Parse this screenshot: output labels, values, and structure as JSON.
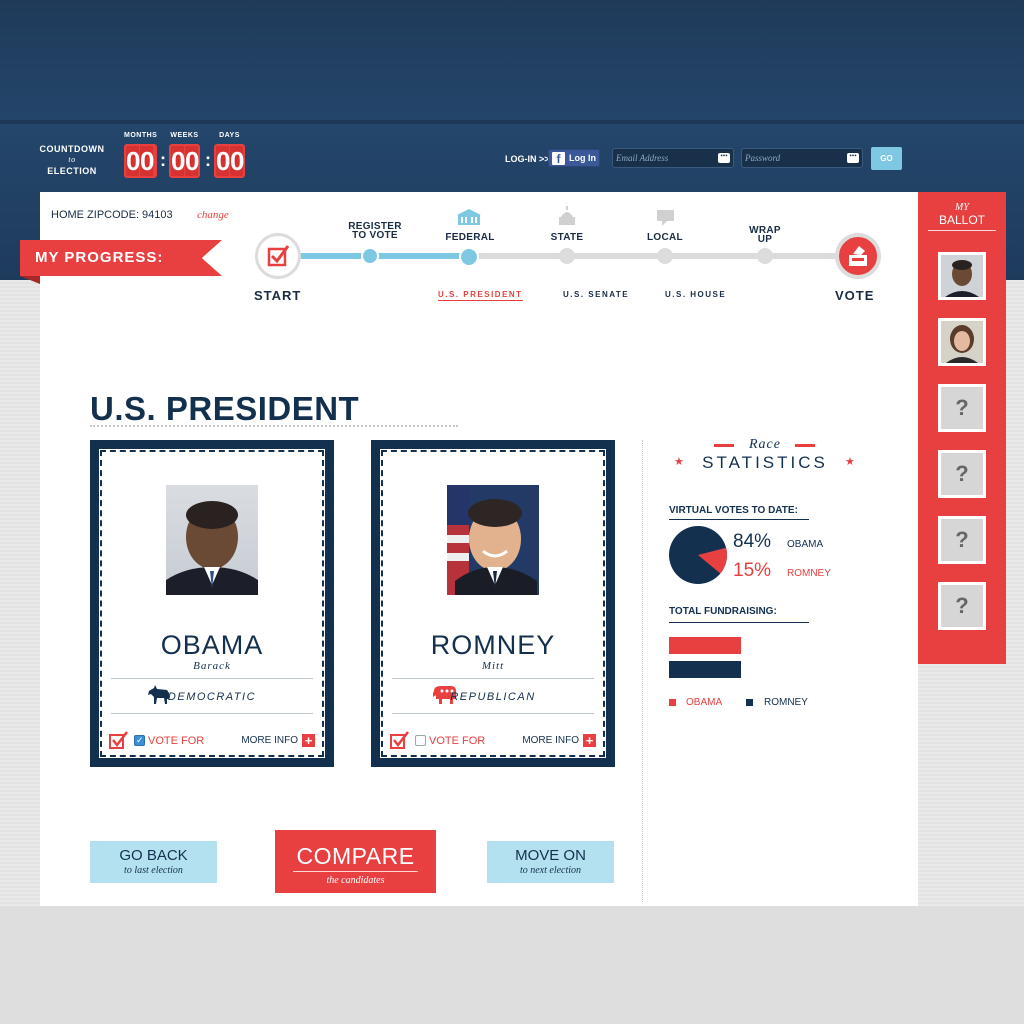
{
  "header": {
    "countdown": {
      "label_top": "COUNTDOWN",
      "label_to": "to",
      "label_bottom": "ELECTION",
      "units": [
        {
          "label": "MONTHS",
          "d1": "0",
          "d2": "0"
        },
        {
          "label": "WEEKS",
          "d1": "0",
          "d2": "0"
        },
        {
          "label": "DAYS",
          "d1": "0",
          "d2": "0"
        }
      ],
      "separator": ":"
    },
    "login": {
      "label": "LOG-IN >>",
      "facebook_label": "Log In",
      "facebook_icon": "facebook-icon",
      "email_placeholder": "Email Address",
      "password_placeholder": "Password",
      "field_dots": "•••",
      "go_label": "GO"
    }
  },
  "progress": {
    "zipcode_label": "HOME ZIPCODE: 94103",
    "change_label": "change",
    "ribbon_label": "MY PROGRESS:",
    "start_label": "START",
    "vote_label": "VOTE",
    "steps": [
      {
        "label1": "REGISTER",
        "label2": "TO VOTE"
      },
      {
        "label1": "FEDERAL",
        "label2": ""
      },
      {
        "label1": "STATE",
        "label2": ""
      },
      {
        "label1": "LOCAL",
        "label2": ""
      },
      {
        "label1": "WRAP",
        "label2": "UP"
      }
    ],
    "node_dots": "•••",
    "substeps": [
      "U.S. PRESIDENT",
      "U.S. SENATE",
      "U.S. HOUSE"
    ],
    "active_substep": "U.S. PRESIDENT"
  },
  "race": {
    "title": "U.S. PRESIDENT",
    "candidates": [
      {
        "last": "OBAMA",
        "first": "Barack",
        "party": "DEMOCRATIC",
        "vote_label": "VOTE FOR",
        "more_label": "MORE INFO",
        "selected": true
      },
      {
        "last": "ROMNEY",
        "first": "Mitt",
        "party": "REPUBLICAN",
        "vote_label": "VOTE FOR",
        "more_label": "MORE INFO",
        "selected": false
      }
    ],
    "plus": "+"
  },
  "stats": {
    "race_word": "Race",
    "title": "STATISTICS",
    "star": "★",
    "votes_heading": "VIRTUAL VOTES TO DATE:",
    "obama_pct": "84%",
    "obama_name": "OBAMA",
    "romney_pct": "15%",
    "romney_name": "ROMNEY",
    "obama_share": 84,
    "romney_share": 15,
    "fund_heading": "TOTAL FUNDRAISING:",
    "legend_obama": "OBAMA",
    "legend_romney": "ROMNEY",
    "colors": {
      "obama": "#e84040",
      "romney": "#14304f"
    }
  },
  "nav": {
    "back_big": "GO BACK",
    "back_small": "to last election",
    "compare_big": "COMPARE",
    "compare_small": "the candidates",
    "next_big": "MOVE ON",
    "next_small": "to next election"
  },
  "ballot": {
    "my": "MY",
    "label": "BALLOT",
    "unknown": "?"
  },
  "colors": {
    "navy": "#14304f",
    "red": "#e84040",
    "light_blue": "#7ec8e3"
  }
}
